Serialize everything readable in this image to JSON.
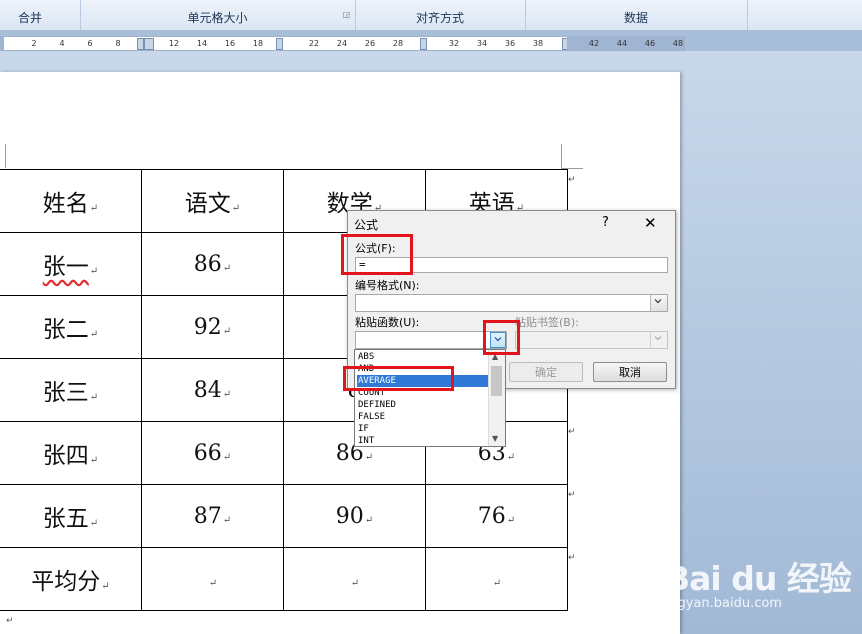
{
  "ribbon": {
    "groups": [
      {
        "label": "合并"
      },
      {
        "label": "单元格大小"
      },
      {
        "label": "对齐方式"
      },
      {
        "label": "数据"
      }
    ]
  },
  "ruler": {
    "ticks_left": [
      "2",
      "4",
      "6",
      "8"
    ],
    "ticks_mid1": [
      "12",
      "14",
      "16",
      "18"
    ],
    "ticks_mid2": [
      "22",
      "24",
      "26",
      "28"
    ],
    "ticks_mid3": [
      "32",
      "34",
      "36",
      "38"
    ],
    "ticks_right": [
      "42",
      "44",
      "46",
      "48"
    ]
  },
  "table": {
    "rows": [
      {
        "name": "姓名",
        "c1": "语文",
        "c2": "数学",
        "c3": "英语"
      },
      {
        "name": "张一",
        "c1": "86",
        "c2": "8",
        "c3": ""
      },
      {
        "name": "张二",
        "c1": "92",
        "c2": "8",
        "c3": ""
      },
      {
        "name": "张三",
        "c1": "84",
        "c2": "8",
        "c3": ""
      },
      {
        "name": "张四",
        "c1": "66",
        "c2": "86",
        "c3": "63"
      },
      {
        "name": "张五",
        "c1": "87",
        "c2": "90",
        "c3": "76"
      },
      {
        "name": "平均分",
        "c1": "",
        "c2": "",
        "c3": ""
      }
    ],
    "cell_mark": "↵"
  },
  "dialog": {
    "title": "公式",
    "help": "?",
    "close": "✕",
    "formula_label": "公式(F):",
    "formula_value": "=",
    "number_format_label": "编号格式(N):",
    "number_format_value": "",
    "paste_function_label": "粘贴函数(U):",
    "paste_bookmark_label": "粘贴书签(B):",
    "ok": "确定",
    "cancel": "取消"
  },
  "function_list": {
    "items": [
      "ABS",
      "AND",
      "AVERAGE",
      "COUNT",
      "DEFINED",
      "FALSE",
      "IF",
      "INT"
    ],
    "selected": "AVERAGE"
  },
  "watermark": {
    "main": "Bai du 经验",
    "sub": "jingyan.baidu.com"
  },
  "colors": {
    "annotation_red": "#e3141b",
    "selection_blue": "#3079d6"
  }
}
